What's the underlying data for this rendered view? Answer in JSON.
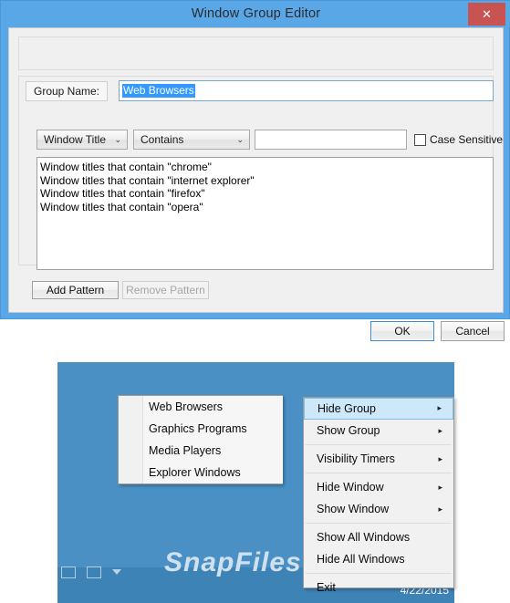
{
  "dialog": {
    "title": "Window Group Editor",
    "close_icon": "close-icon",
    "group_name": {
      "label": "Group Name:",
      "value": "Web Browsers"
    },
    "filter_row": {
      "field_combo": {
        "selected": "Window Title",
        "arrow": "⌄"
      },
      "operator_combo": {
        "selected": "Contains",
        "arrow": "⌄"
      },
      "pattern_input": {
        "value": "",
        "placeholder": ""
      },
      "case_sensitive": {
        "label": "Case Sensitive",
        "checked": false
      }
    },
    "pattern_list": [
      "Window titles that contain \"chrome\"",
      "Window titles that contain \"internet explorer\"",
      "Window titles that contain \"firefox\"",
      "Window titles that contain \"opera\""
    ],
    "buttons": {
      "add_pattern": "Add Pattern",
      "remove_pattern": "Remove Pattern",
      "ok": "OK",
      "cancel": "Cancel"
    },
    "watermark": "SnapFiles"
  },
  "desktop": {
    "taskbar_date": "4/22/2015",
    "watermark": "SnapFiles",
    "group_submenu": [
      "Web Browsers",
      "Graphics Programs",
      "Media Players",
      "Explorer Windows"
    ],
    "tray_menu": [
      {
        "label": "Hide Group",
        "arrow": "▸",
        "highlighted": true
      },
      {
        "label": "Show Group",
        "arrow": "▸",
        "highlighted": false
      },
      {
        "label": "Visibility Timers",
        "arrow": "▸",
        "highlighted": false
      },
      {
        "label": "Hide Window",
        "arrow": "▸",
        "highlighted": false
      },
      {
        "label": "Show Window",
        "arrow": "▸",
        "highlighted": false
      },
      {
        "label": "Show All Windows",
        "arrow": "",
        "highlighted": false
      },
      {
        "label": "Hide All Windows",
        "arrow": "",
        "highlighted": false
      },
      {
        "label": "Exit",
        "arrow": "",
        "highlighted": false
      }
    ]
  },
  "colors": {
    "window_frame": "#5aa7e8",
    "close_button": "#c75450",
    "selection": "#3399ff",
    "menu_highlight": "#cde8f9",
    "desktop": "#4a90c4",
    "taskbar": "#3e83b6"
  }
}
